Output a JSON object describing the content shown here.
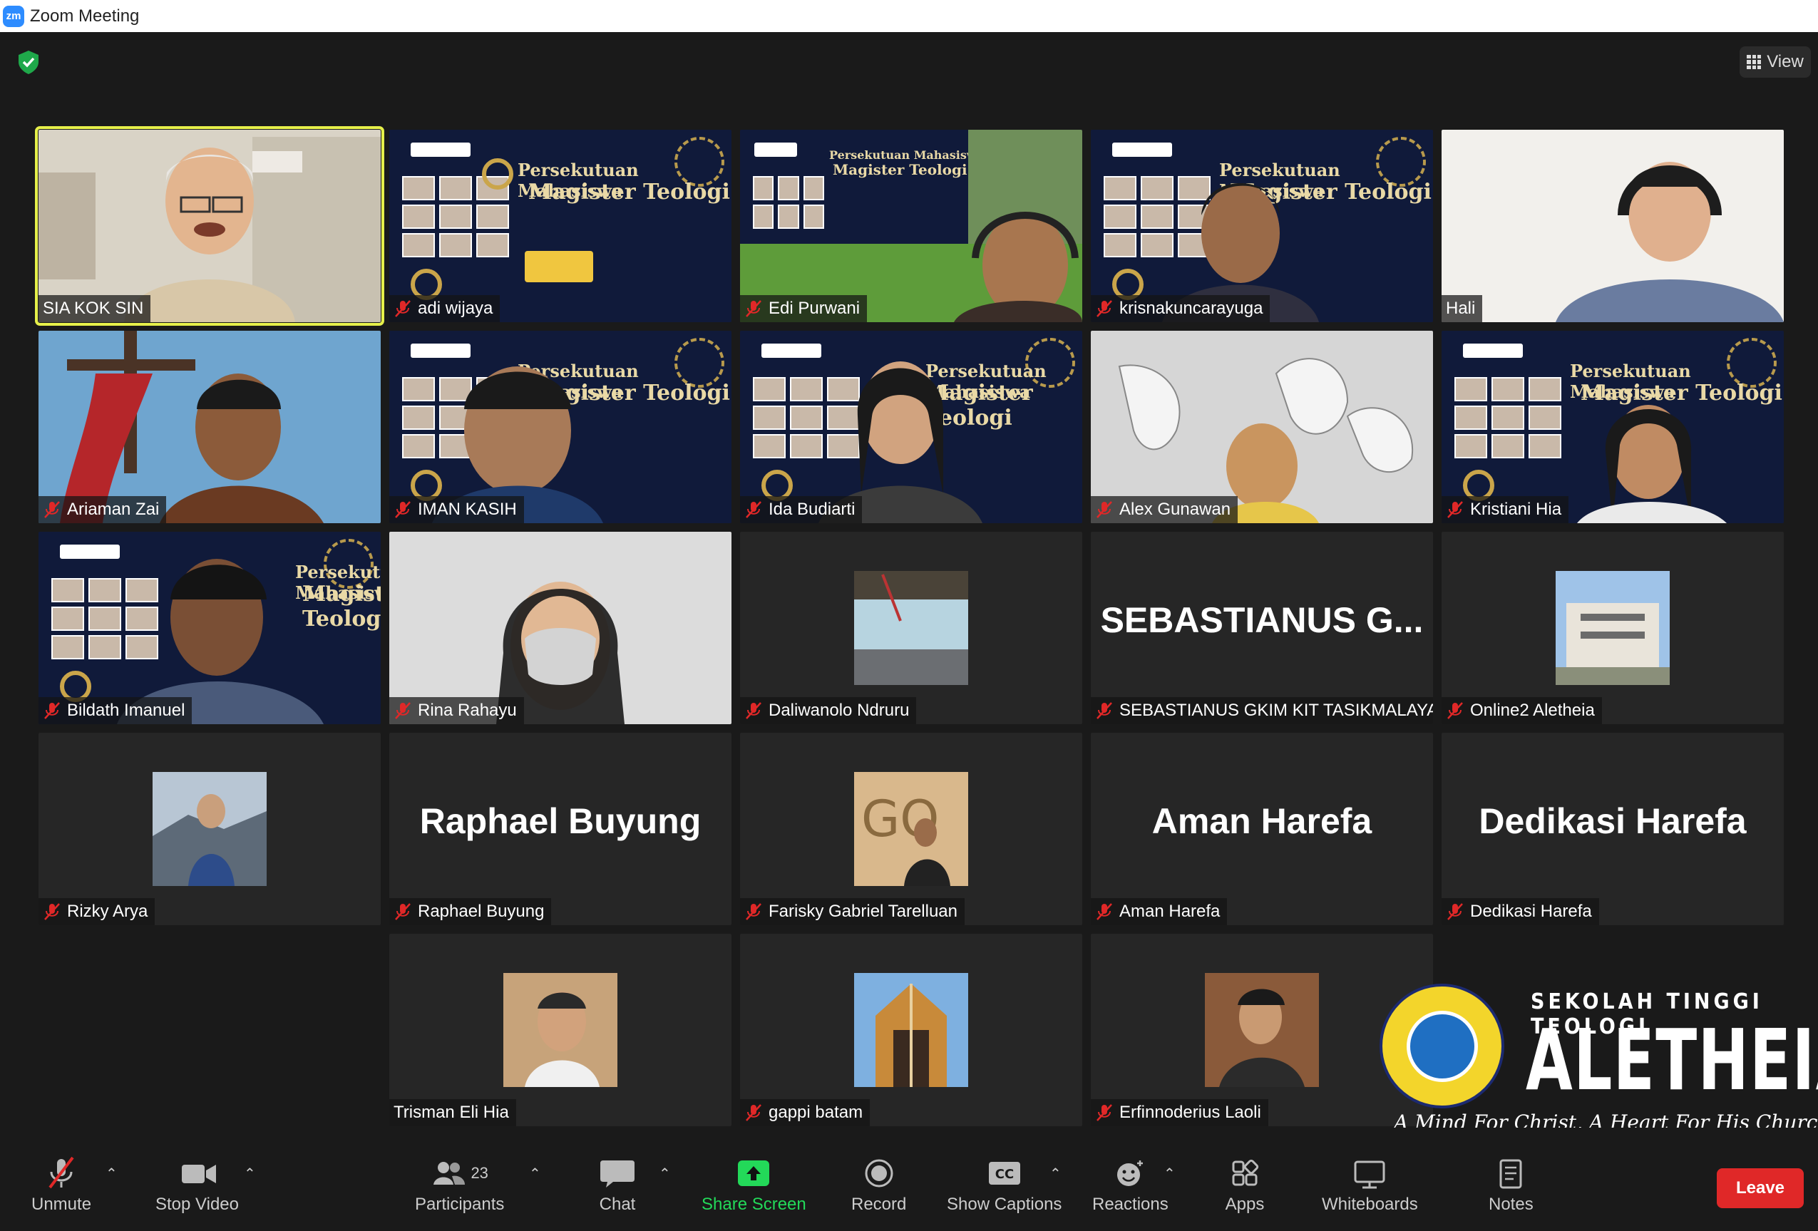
{
  "window": {
    "title": "Zoom Meeting",
    "app_icon": "zm"
  },
  "top": {
    "view_label": "View"
  },
  "tiles": [
    {
      "name": "SIA KOK SIN",
      "muted": false,
      "active": true,
      "kind": "video"
    },
    {
      "name": "adi wijaya",
      "muted": true,
      "kind": "poster"
    },
    {
      "name": "Edi Purwani",
      "muted": true,
      "kind": "poster-person"
    },
    {
      "name": "krisnakuncarayuga",
      "muted": true,
      "kind": "poster-person"
    },
    {
      "name": "Hali",
      "muted": false,
      "kind": "video"
    },
    {
      "name": "Ariaman Zai",
      "muted": true,
      "kind": "video"
    },
    {
      "name": "IMAN KASIH",
      "muted": true,
      "kind": "poster-person"
    },
    {
      "name": "Ida Budiarti",
      "muted": true,
      "kind": "poster-person"
    },
    {
      "name": "Alex Gunawan",
      "muted": true,
      "kind": "video"
    },
    {
      "name": "Kristiani Hia",
      "muted": true,
      "kind": "poster-person"
    },
    {
      "name": "Bildath Imanuel",
      "muted": true,
      "kind": "poster-person"
    },
    {
      "name": "Rina Rahayu",
      "muted": true,
      "kind": "video"
    },
    {
      "name": "Daliwanolo Ndruru",
      "muted": true,
      "kind": "avatar"
    },
    {
      "name": "SEBASTIANUS GKIM KIT TASIKMALAYA",
      "muted": true,
      "kind": "bigname",
      "big": "SEBASTIANUS  G..."
    },
    {
      "name": "Online2 Aletheia",
      "muted": true,
      "kind": "avatar"
    },
    {
      "name": "Rizky Arya",
      "muted": true,
      "kind": "avatar"
    },
    {
      "name": "Raphael Buyung",
      "muted": true,
      "kind": "bigname",
      "big": "Raphael Buyung"
    },
    {
      "name": "Farisky Gabriel Tarelluan",
      "muted": true,
      "kind": "avatar"
    },
    {
      "name": "Aman Harefa",
      "muted": true,
      "kind": "bigname",
      "big": "Aman Harefa"
    },
    {
      "name": "Dedikasi Harefa",
      "muted": true,
      "kind": "bigname",
      "big": "Dedikasi Harefa"
    },
    {
      "name": "Trisman Eli Hia",
      "muted": false,
      "kind": "avatar"
    },
    {
      "name": "gappi batam",
      "muted": true,
      "kind": "avatar"
    },
    {
      "name": "Erfinnoderius Laoli",
      "muted": true,
      "kind": "avatar"
    }
  ],
  "poster": {
    "line1": "Persekutuan Mahasiswa",
    "line2": "Magister Teologi"
  },
  "brand": {
    "top": "SEKOLAH TINGGI TEOLOGI",
    "main": "ALETHEIA",
    "tagline": "A Mind For Christ, A Heart For His Church"
  },
  "toolbar": {
    "unmute": "Unmute",
    "stop_video": "Stop Video",
    "participants": "Participants",
    "participants_count": "23",
    "chat": "Chat",
    "share_screen": "Share Screen",
    "record": "Record",
    "show_captions": "Show Captions",
    "reactions": "Reactions",
    "apps": "Apps",
    "whiteboards": "Whiteboards",
    "notes": "Notes",
    "leave": "Leave"
  },
  "colors": {
    "accent_green": "#23d959",
    "leave_red": "#e02828",
    "active_border": "#e6f04a",
    "mute_red": "#e02828"
  }
}
